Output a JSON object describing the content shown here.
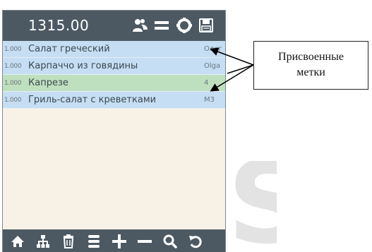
{
  "header": {
    "total": "1315.00",
    "icons": [
      "users-icon",
      "menu-icon",
      "gear-icon",
      "save-icon"
    ]
  },
  "order": {
    "items": [
      {
        "qty": "1.000",
        "name": "Салат греческий",
        "tag": "Олег",
        "bg": "#c5def3"
      },
      {
        "qty": "1.000",
        "name": "Карпаччо из говядины",
        "tag": "Olga",
        "bg": "#c5def3"
      },
      {
        "qty": "1.000",
        "name": "Капрезе",
        "tag": "4",
        "bg": "#bfe0bf"
      },
      {
        "qty": "1.000",
        "name": "Гриль-салат с креветками",
        "tag": "M3",
        "bg": "#c5def3"
      }
    ]
  },
  "footer": {
    "icons": [
      "home-icon",
      "hierarchy-icon",
      "trash-icon",
      "database-icon",
      "plus-icon",
      "minus-icon",
      "search-icon",
      "undo-icon"
    ]
  },
  "annotation": {
    "line1": "Присвоенные",
    "line2": "метки"
  },
  "colors": {
    "bar": "#4c5963",
    "row_blue": "#c5def3",
    "row_green": "#bfe0bf",
    "list_bg": "#f8f2e6"
  }
}
